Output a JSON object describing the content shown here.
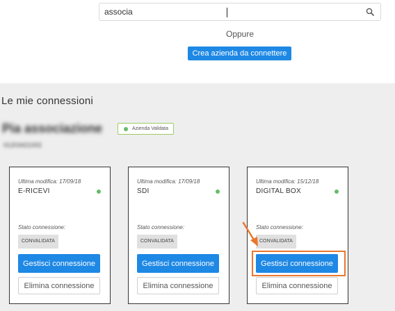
{
  "search": {
    "value": "associa"
  },
  "alt_text": "Oppure",
  "create_button_label": "Crea azienda da connettere",
  "section_title": "Le mie connessioni",
  "organization": {
    "name": "Pia associazione",
    "code": "01203421002",
    "badge": "Azienda Validata"
  },
  "colors": {
    "primary": "#1e88e5",
    "status_green": "#66bb6a",
    "highlight": "#e8772e",
    "panel_bg": "#eeeeee"
  },
  "connections": [
    {
      "modified": "Ultima modifica: 17/09/18",
      "name": "E-RICEVI",
      "status_label": "Stato connessione:",
      "status": "CONVALIDATA",
      "manage_label": "Gestisci connessione",
      "delete_label": "Elimina connessione"
    },
    {
      "modified": "Ultima modifica: 17/09/18",
      "name": "SDI",
      "status_label": "Stato connessione:",
      "status": "CONVALIDATA",
      "manage_label": "Gestisci connessione",
      "delete_label": "Elimina connessione"
    },
    {
      "modified": "Ultima modifica: 15/12/18",
      "name": "DIGITAL BOX",
      "status_label": "Stato connessione:",
      "status": "CONVALIDATA",
      "manage_label": "Gestisci connessione",
      "delete_label": "Elimina connessione"
    }
  ]
}
